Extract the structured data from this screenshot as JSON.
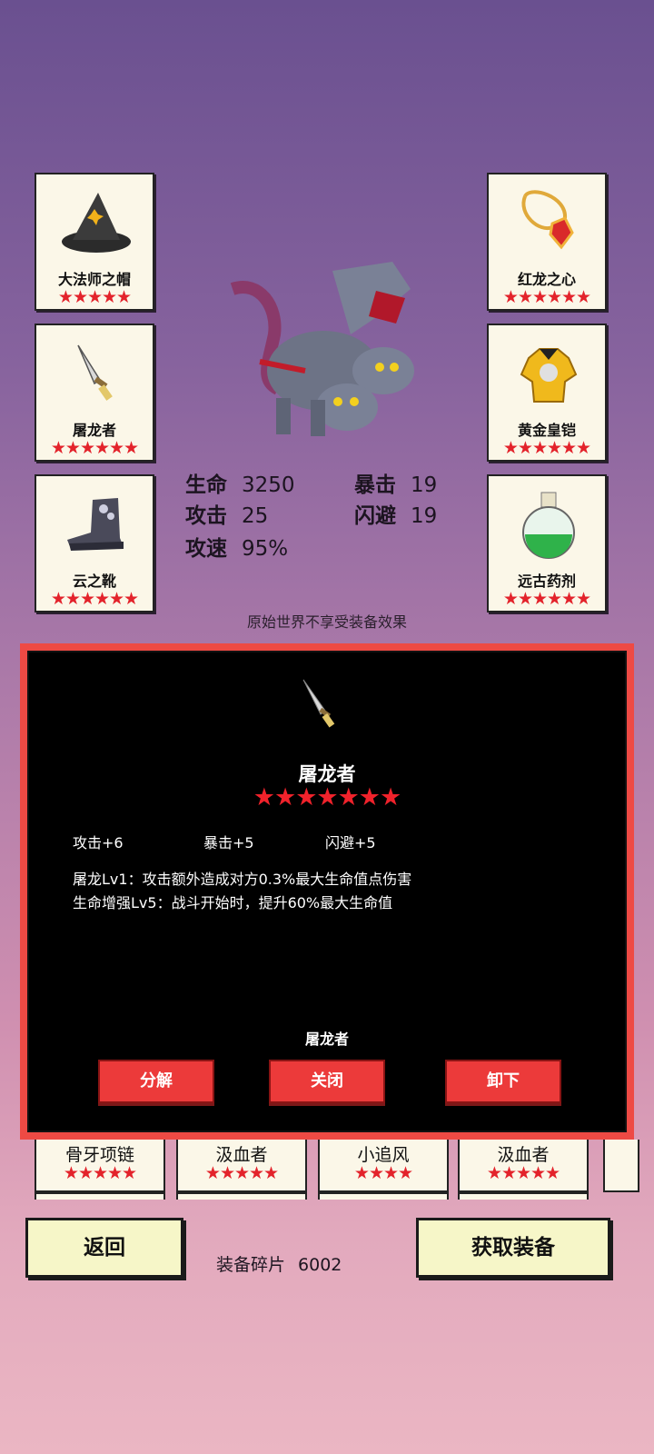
{
  "equipment": {
    "left": [
      {
        "name": "大法师之帽",
        "stars": "★★★★★",
        "icon": "wizard-hat-icon"
      },
      {
        "name": "屠龙者",
        "stars": "★★★★★★",
        "icon": "dagger-icon"
      },
      {
        "name": "云之靴",
        "stars": "★★★★★★",
        "icon": "boot-icon"
      }
    ],
    "right": [
      {
        "name": "红龙之心",
        "stars": "★★★★★★",
        "icon": "amulet-icon"
      },
      {
        "name": "黄金皇铠",
        "stars": "★★★★★★",
        "icon": "gold-armor-icon"
      },
      {
        "name": "远古药剂",
        "stars": "★★★★★★",
        "icon": "potion-icon"
      }
    ]
  },
  "hero": {
    "icon": "three-headed-dragon-icon"
  },
  "stats": {
    "hp_label": "生命",
    "hp_value": "3250",
    "atk_label": "攻击",
    "atk_value": "25",
    "spd_label": "攻速",
    "spd_value": "95%",
    "crit_label": "暴击",
    "crit_value": "19",
    "dodge_label": "闪避",
    "dodge_value": "19"
  },
  "notice": "原始世界不享受装备效果",
  "dialog": {
    "icon": "dagger-icon",
    "title": "屠龙者",
    "stars": "★★★★★★★",
    "attrs": [
      "攻击+6",
      "暴击+5",
      "闪避+5"
    ],
    "skills": [
      "屠龙Lv1：攻击额外造成对方0.3%最大生命值点伤害",
      "生命增强Lv5：战斗开始时，提升60%最大生命值"
    ],
    "subtitle": "屠龙者",
    "buttons": {
      "decompose": "分解",
      "close": "关闭",
      "unequip": "卸下"
    }
  },
  "inventory": [
    {
      "name": "骨牙项链",
      "stars": "★★★★★"
    },
    {
      "name": "汲血者",
      "stars": "★★★★★"
    },
    {
      "name": "小追风",
      "stars": "★★★★"
    },
    {
      "name": "汲血者",
      "stars": "★★★★★"
    }
  ],
  "footer": {
    "back": "返回",
    "fragments_label": "装备碎片",
    "fragments_value": "6002",
    "get_equipment": "获取装备"
  }
}
